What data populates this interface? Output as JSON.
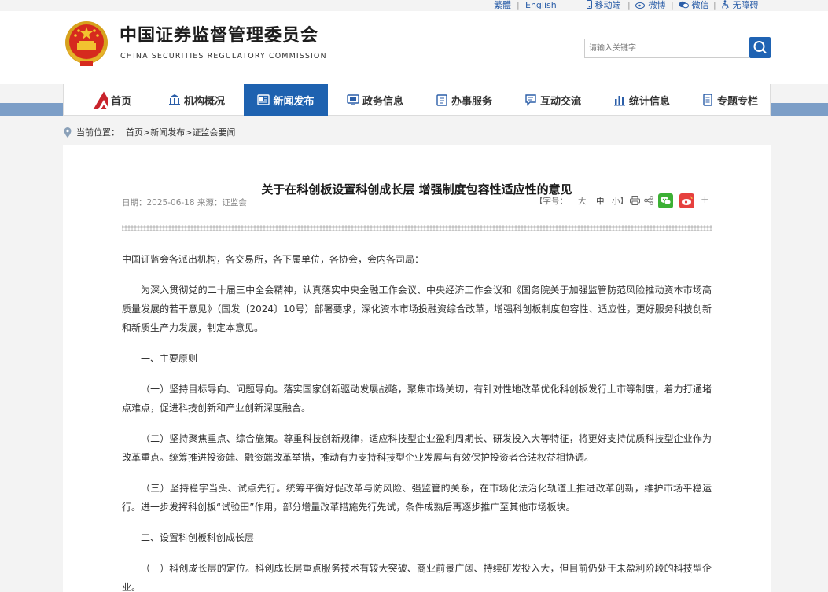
{
  "top_links": {
    "traditional": "繁體",
    "english": "English",
    "mobile": "移动端",
    "weibo": "微博",
    "wechat": "微信",
    "accessibility": "无障碍",
    "separator": "|"
  },
  "header": {
    "title_cn": "中国证券监督管理委员会",
    "title_en": "CHINA SECURITIES REGULATORY COMMISSION"
  },
  "search": {
    "placeholder": "请输入关键字"
  },
  "nav": {
    "items": [
      {
        "label": "首页",
        "icon": "csrc-logo-icon"
      },
      {
        "label": "机构概况",
        "icon": "building-icon"
      },
      {
        "label": "新闻发布",
        "icon": "newspaper-icon"
      },
      {
        "label": "政务信息",
        "icon": "screen-icon"
      },
      {
        "label": "办事服务",
        "icon": "clipboard-icon"
      },
      {
        "label": "互动交流",
        "icon": "chat-icon"
      },
      {
        "label": "统计信息",
        "icon": "bar-chart-icon"
      },
      {
        "label": "专题专栏",
        "icon": "document-icon"
      }
    ],
    "active_index": 2
  },
  "breadcrumb": {
    "label": "当前位置：",
    "home": "首页",
    "news": "新闻发布",
    "current": "证监会要闻",
    "separator": ">"
  },
  "article": {
    "title": "关于在科创板设置科创成长层 增强制度包容性适应性的意见",
    "date_label": "日期：",
    "date": "2025-06-18",
    "source_label": "来源：",
    "source": "证监会",
    "font_size_label": "【字号：",
    "font_large": "大",
    "font_medium": "中",
    "font_small": "小】",
    "paragraphs": [
      "中国证监会各派出机构，各交易所，各下属单位，各协会，会内各司局：",
      "为深入贯彻党的二十届三中全会精神，认真落实中央金融工作会议、中央经济工作会议和《国务院关于加强监管防范风险推动资本市场高质量发展的若干意见》（国发〔2024〕10号）部署要求，深化资本市场投融资综合改革，增强科创板制度包容性、适应性，更好服务科技创新和新质生产力发展，制定本意见。",
      "一、主要原则",
      "（一）坚持目标导向、问题导向。落实国家创新驱动发展战略，聚焦市场关切，有针对性地改革优化科创板发行上市等制度，着力打通堵点难点，促进科技创新和产业创新深度融合。",
      "（二）坚持聚焦重点、综合施策。尊重科技创新规律，适应科技型企业盈利周期长、研发投入大等特征，将更好支持优质科技型企业作为改革重点。统筹推进投资端、融资端改革举措，推动有力支持科技型企业发展与有效保护投资者合法权益相协调。",
      "（三）坚持稳字当头、试点先行。统筹平衡好促改革与防风险、强监管的关系，在市场化法治化轨道上推进改革创新，维护市场平稳运行。进一步发挥科创板“试验田”作用，部分增量改革措施先行先试，条件成熟后再逐步推广至其他市场板块。",
      "二、设置科创板科创成长层",
      "（一）科创成长层的定位。科创成长层重点服务技术有较大突破、商业前景广阔、持续研发投入大，但目前仍处于未盈利阶段的科技型企业。"
    ]
  }
}
